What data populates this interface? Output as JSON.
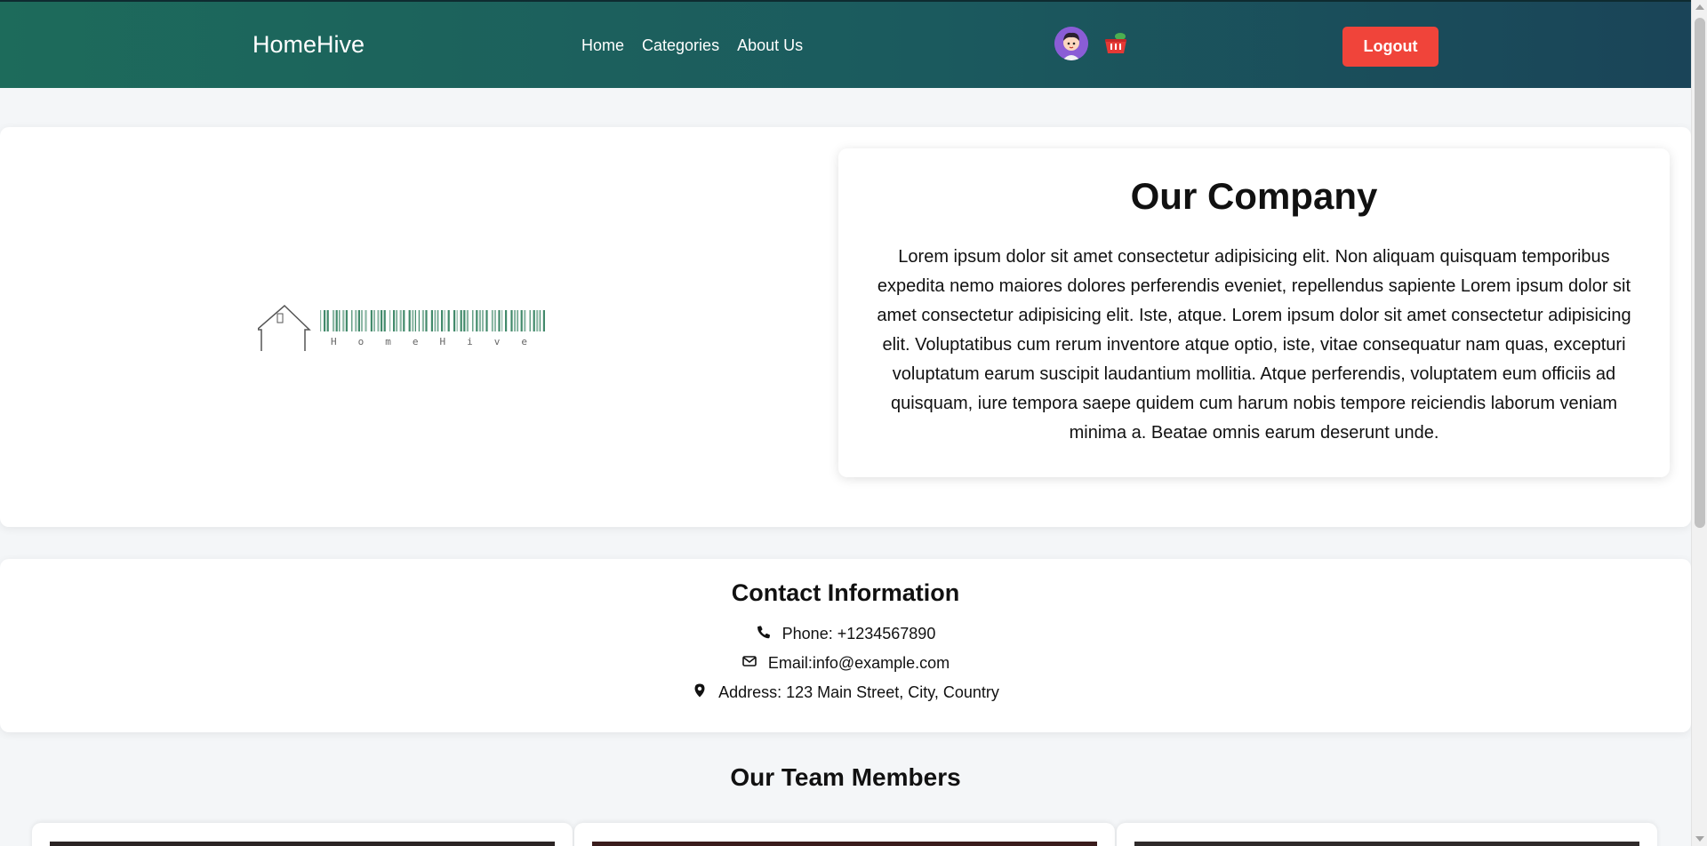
{
  "navbar": {
    "brand": "HomeHive",
    "links": [
      "Home",
      "Categories",
      "About Us"
    ],
    "logout_label": "Logout",
    "profile_icon": "user-avatar-icon",
    "cart_icon": "shopping-basket-icon"
  },
  "company": {
    "logo_text": "HomeHive",
    "title": "Our Company",
    "description": "Lorem ipsum dolor sit amet consectetur adipisicing elit. Non aliquam quisquam temporibus expedita nemo maiores dolores perferendis eveniet, repellendus sapiente Lorem ipsum dolor sit amet consectetur adipisicing elit. Iste, atque. Lorem ipsum dolor sit amet consectetur adipisicing elit. Voluptatibus cum rerum inventore atque optio, iste, vitae consequatur nam quas, excepturi voluptatum earum suscipit laudantium mollitia. Atque perferendis, voluptatem eum officiis ad quisquam, iure tempora saepe quidem cum harum nobis tempore reiciendis laborum veniam minima a. Beatae omnis earum deserunt unde."
  },
  "contact": {
    "title": "Contact Information",
    "phone": "Phone: +1234567890",
    "email": "Email:info@example.com",
    "address": "Address: 123 Main Street, City, Country"
  },
  "team": {
    "title": "Our Team Members"
  },
  "colors": {
    "nav_gradient_start": "#1d6b5b",
    "nav_gradient_end": "#1a4458",
    "logout": "#f0443a"
  }
}
